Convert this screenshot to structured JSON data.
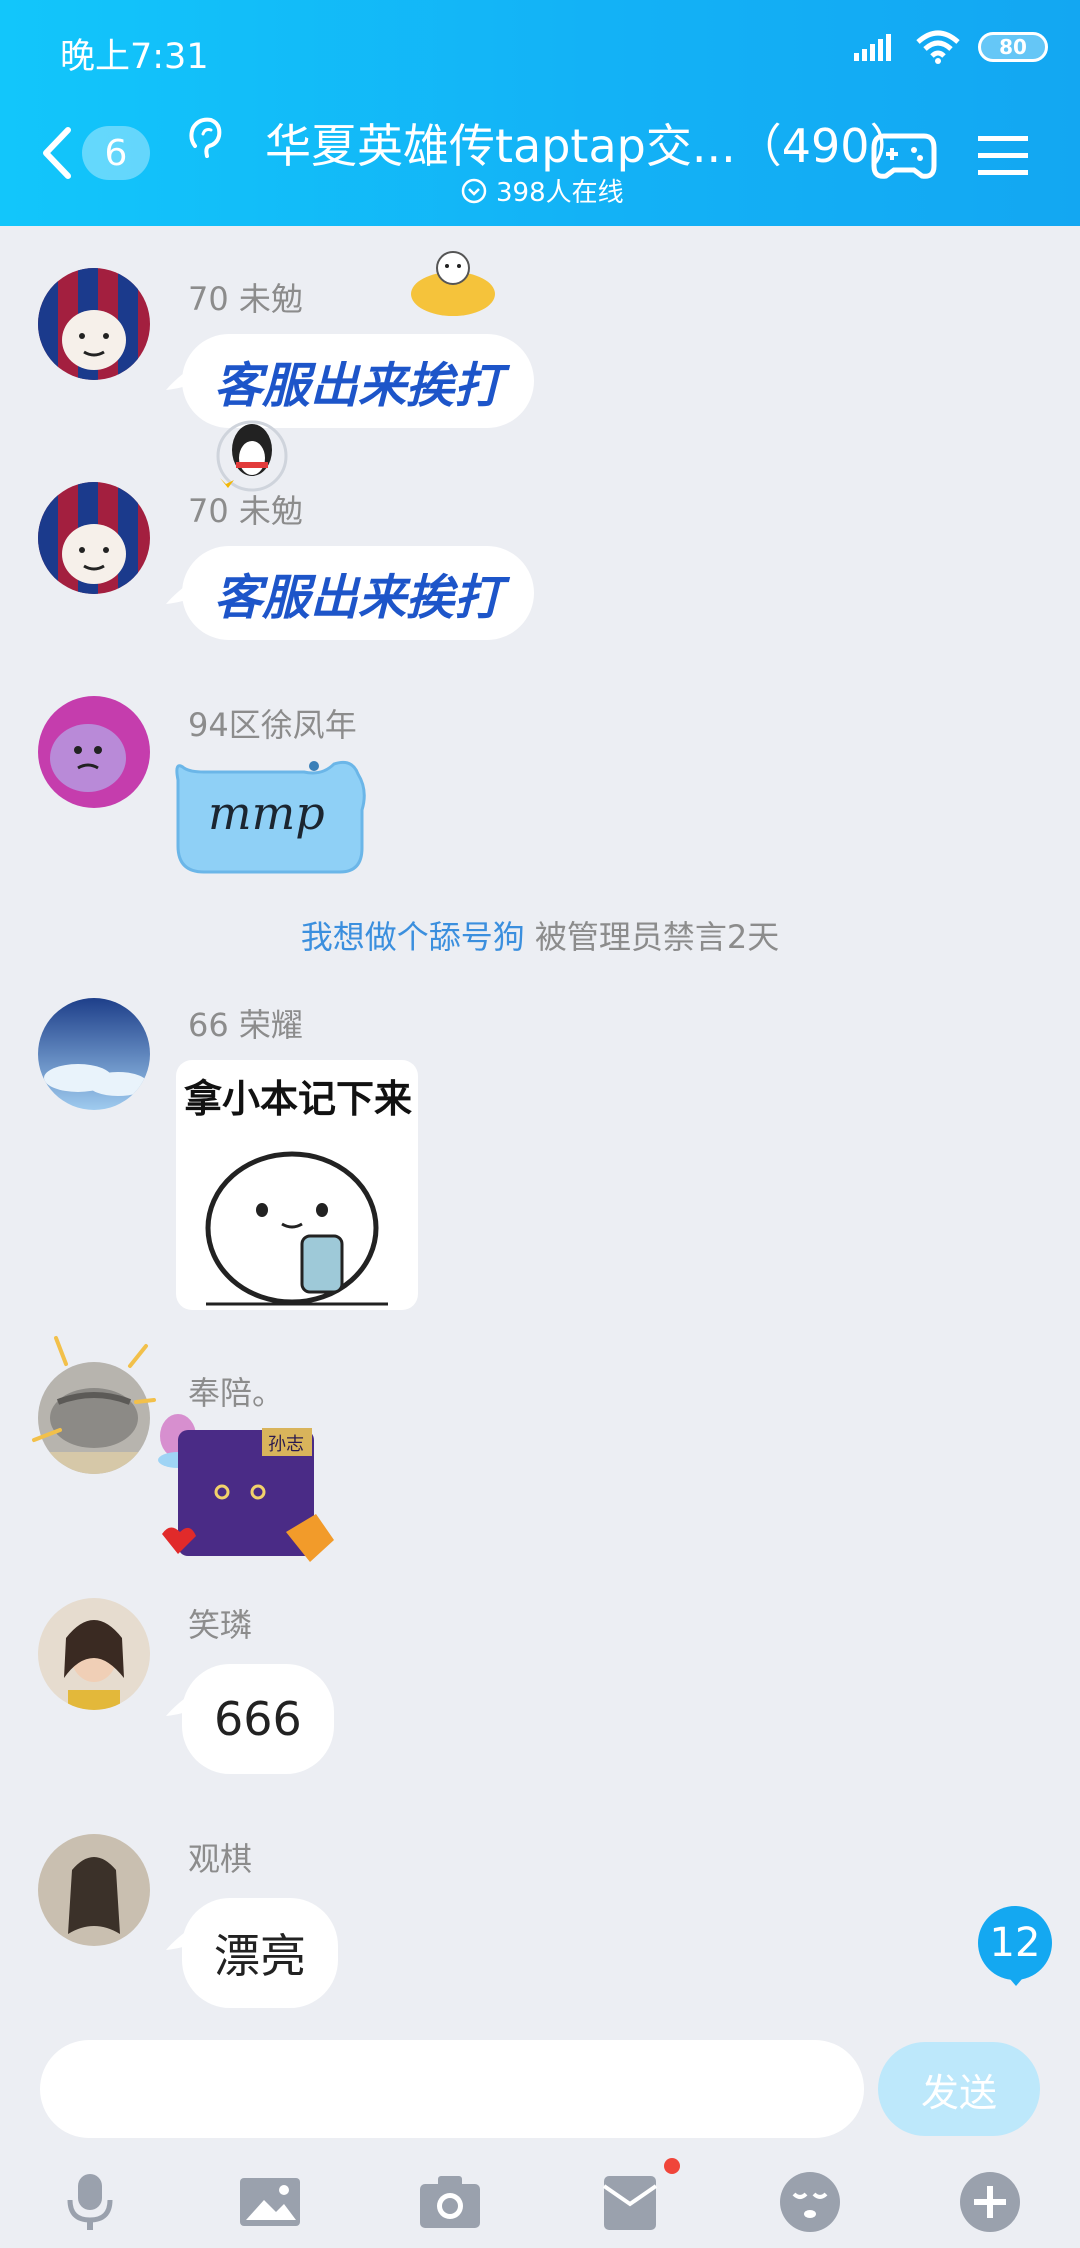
{
  "status_bar": {
    "time": "晚上7:31",
    "battery": "80"
  },
  "header": {
    "back_count": "6",
    "title": "华夏英雄传taptap交...（490）",
    "online": "398人在线"
  },
  "messages": [
    {
      "sender": "70 未勉",
      "text": "客服出来挨打",
      "style": "fancy"
    },
    {
      "sender": "70 未勉",
      "text": "客服出来挨打",
      "style": "fancy"
    },
    {
      "sender": "94区徐凤年",
      "text": "mmp",
      "style": "sticker-bubble"
    },
    {
      "sender": "66 荣耀",
      "sticker_text": "拿小本记下来",
      "style": "sticker"
    },
    {
      "sender": "奉陪。",
      "sticker_text": "孙志",
      "style": "sticker"
    },
    {
      "sender": "笑璘",
      "text": "666",
      "style": "plain"
    },
    {
      "sender": "观棋",
      "text": "漂亮",
      "style": "plain"
    }
  ],
  "notice": {
    "who": "我想做个舔号狗",
    "action": " 被管理员禁言2天"
  },
  "unread_count": "12",
  "input": {
    "placeholder": "",
    "send_label": "发送"
  },
  "toolbar_icons": [
    "microphone-icon",
    "image-icon",
    "camera-icon",
    "red-packet-icon",
    "emoji-icon",
    "plus-icon"
  ],
  "colors": {
    "header": "#13b2f6",
    "accent": "#14a8f1",
    "bubble_fancy_text": "#1d55c9",
    "background": "#eceef3"
  }
}
